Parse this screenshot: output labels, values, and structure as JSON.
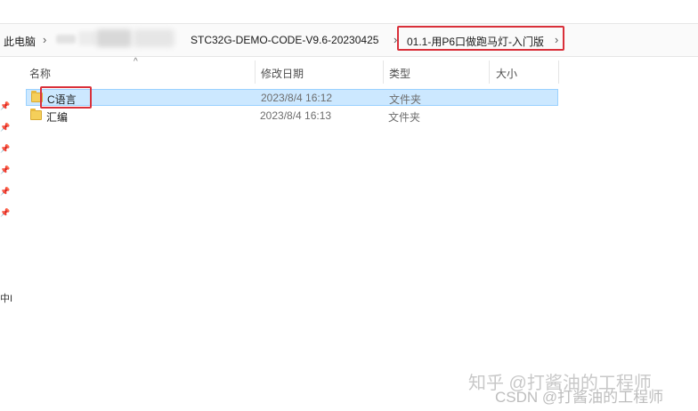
{
  "breadcrumb": {
    "root": "此电脑",
    "folder": "STC32G-DEMO-CODE-V9.6-20230425",
    "current": "01.1-用P6口做跑马灯-入门版",
    "separator": "›"
  },
  "columns": {
    "name": "名称",
    "date": "修改日期",
    "type": "类型",
    "size": "大小"
  },
  "files": [
    {
      "name": "C语言",
      "date": "2023/8/4 16:12",
      "type": "文件夹",
      "size": "",
      "selected": true
    },
    {
      "name": "汇编",
      "date": "2023/8/4 16:13",
      "type": "文件夹",
      "size": "",
      "selected": false
    }
  ],
  "sidebar": {
    "pin_icon": "📌",
    "partial_label": "中I"
  },
  "watermark": {
    "line1": "知乎 @打酱油的工程师",
    "line2": "CSDN @打酱油的工程师"
  }
}
